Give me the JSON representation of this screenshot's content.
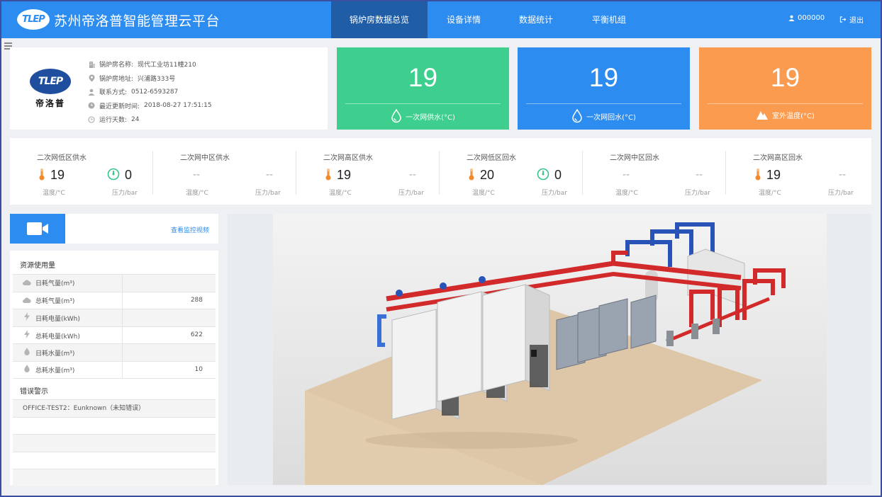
{
  "header": {
    "logo_text": "TLEP",
    "app_title": "苏州帝洛普智能管理云平台",
    "tabs": [
      {
        "label": "锅炉房数据总览",
        "active": true
      },
      {
        "label": "设备详情",
        "active": false
      },
      {
        "label": "数据统计",
        "active": false
      },
      {
        "label": "平衡机组",
        "active": false
      }
    ],
    "user": "000000",
    "logout": "退出"
  },
  "info": {
    "brand_mark": "TLEP",
    "brand_name": "帝洛普",
    "rows": [
      {
        "icon": "building-icon",
        "label": "锅炉房名称:",
        "value": "现代工业坊11幢210"
      },
      {
        "icon": "location-pin-icon",
        "label": "锅炉房地址:",
        "value": "兴浦路333号"
      },
      {
        "icon": "user-icon",
        "label": "联系方式:",
        "value": "0512-6593287"
      },
      {
        "icon": "clock-icon",
        "label": "最近更新时间:",
        "value": "2018-08-27 17:51:15"
      },
      {
        "icon": "history-icon",
        "label": "运行天数:",
        "value": "24"
      }
    ]
  },
  "metrics": [
    {
      "value": "19",
      "label": "一次网供水(°C)",
      "color": "#3ecf8e",
      "icon": "water-drop-icon"
    },
    {
      "value": "19",
      "label": "一次网回水(°C)",
      "color": "#2c8cf0",
      "icon": "water-drop-icon"
    },
    {
      "value": "19",
      "label": "室外温度(°C)",
      "color": "#fb9b4f",
      "icon": "mountain-icon"
    }
  ],
  "sensors": [
    {
      "title": "二次网低区供水",
      "temp": "19",
      "pressure": "0",
      "temp_unit": "温度/°C",
      "pressure_unit": "压力/bar"
    },
    {
      "title": "二次网中区供水",
      "temp": "--",
      "pressure": "--",
      "temp_unit": "温度/°C",
      "pressure_unit": "压力/bar"
    },
    {
      "title": "二次网高区供水",
      "temp": "19",
      "pressure": "--",
      "temp_unit": "温度/°C",
      "pressure_unit": "压力/bar"
    },
    {
      "title": "二次网低区回水",
      "temp": "20",
      "pressure": "0",
      "temp_unit": "温度/°C",
      "pressure_unit": "压力/bar"
    },
    {
      "title": "二次网中区回水",
      "temp": "--",
      "pressure": "--",
      "temp_unit": "温度/°C",
      "pressure_unit": "压力/bar"
    },
    {
      "title": "二次网高区回水",
      "temp": "19",
      "pressure": "--",
      "temp_unit": "温度/°C",
      "pressure_unit": "压力/bar"
    }
  ],
  "camera": {
    "link": "查看监控视频"
  },
  "resources": {
    "title": "资源使用量",
    "rows": [
      {
        "icon": "cloud-icon",
        "name": "日耗气量(m³)",
        "value": ""
      },
      {
        "icon": "cloud-icon",
        "name": "总耗气量(m³)",
        "value": "288"
      },
      {
        "icon": "lightning-icon",
        "name": "日耗电量(kWh)",
        "value": ""
      },
      {
        "icon": "lightning-icon",
        "name": "总耗电量(kWh)",
        "value": "622"
      },
      {
        "icon": "water-drop-icon",
        "name": "日耗水量(m³)",
        "value": ""
      },
      {
        "icon": "water-drop-icon",
        "name": "总耗水量(m³)",
        "value": "10"
      }
    ]
  },
  "errors": {
    "title": "错误警示",
    "rows": [
      "OFFICE-TEST2：Eunknown（未知错误）",
      "",
      "",
      "",
      ""
    ]
  }
}
